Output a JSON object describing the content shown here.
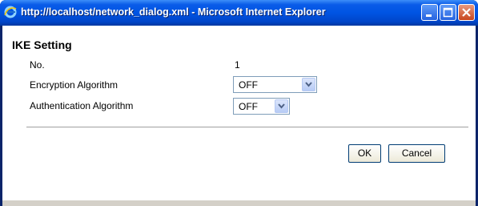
{
  "window": {
    "title": "http://localhost/network_dialog.xml - Microsoft Internet Explorer",
    "colors": {
      "titlebar": "#0054e3",
      "frame": "#0a246a",
      "close": "#c8461e"
    },
    "icons": [
      "ie-icon",
      "minimize-icon",
      "maximize-icon",
      "close-icon"
    ]
  },
  "dialog": {
    "heading": "IKE Setting",
    "fields": {
      "no_label": "No.",
      "no_value": "1",
      "encryption_label": "Encryption Algorithm",
      "encryption_value": "OFF",
      "authentication_label": "Authentication Algorithm",
      "authentication_value": "OFF"
    },
    "buttons": {
      "ok": "OK",
      "cancel": "Cancel"
    }
  }
}
